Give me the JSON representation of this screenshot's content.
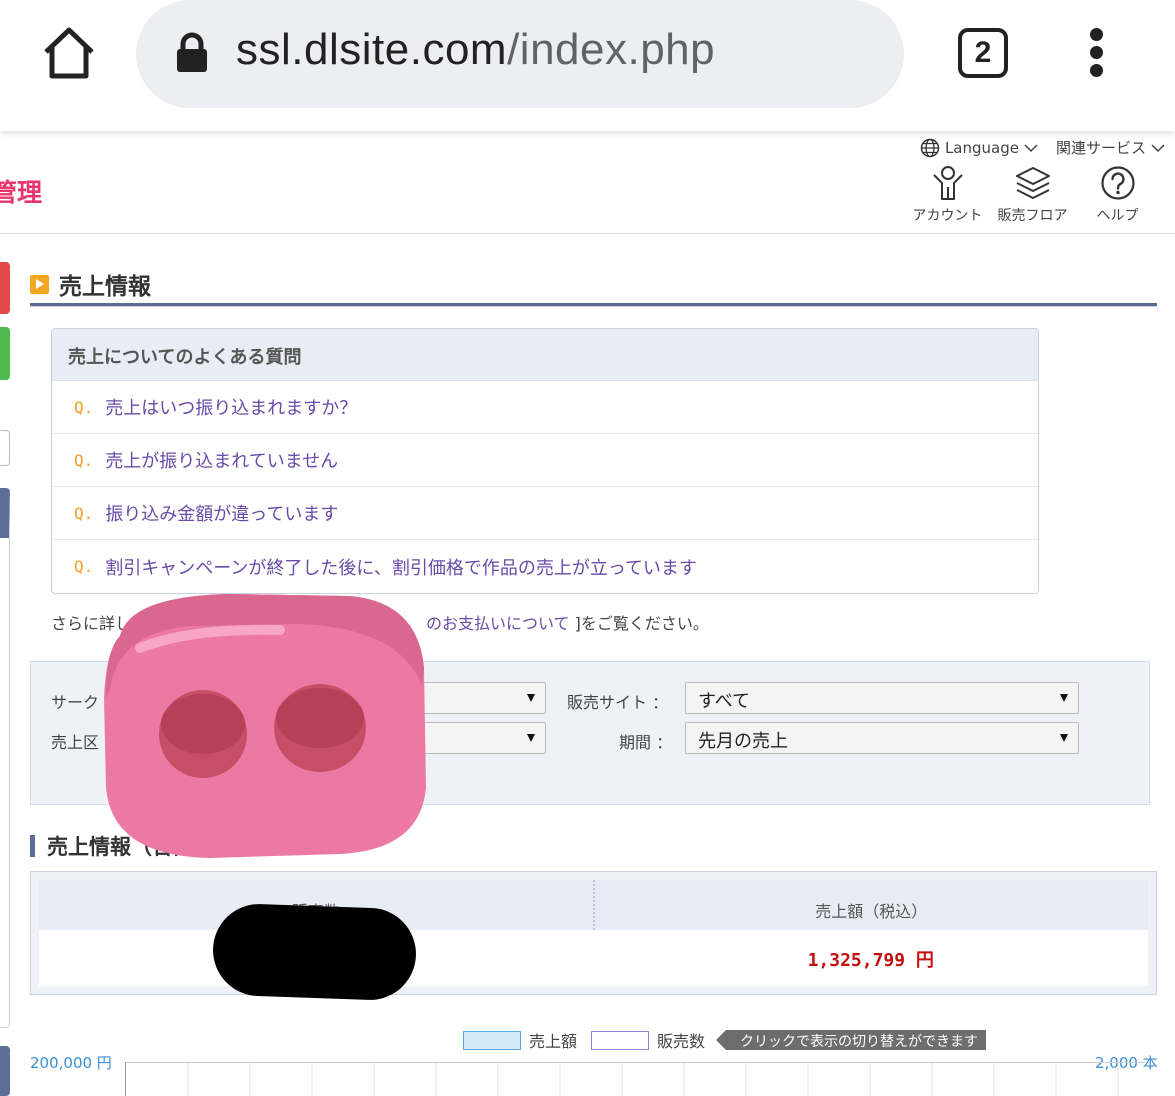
{
  "browser": {
    "url_host": "ssl.dlsite.com",
    "url_path": "/index.php",
    "tab_count": "2"
  },
  "header": {
    "brand_fragment": "管理",
    "language_label": "Language",
    "related_services_label": "関連サービス",
    "nav": [
      {
        "label": "アカウント",
        "icon": "account-icon"
      },
      {
        "label": "販売フロア",
        "icon": "layers-icon"
      },
      {
        "label": "ヘルプ",
        "icon": "help-icon"
      }
    ]
  },
  "section_title": "売上情報",
  "faq": {
    "heading": "売上についてのよくある質問",
    "q_marker": "Q.",
    "items": [
      "売上はいつ振り込まれますか？",
      "売上が振り込まれていません",
      "振り込み金額が違っています",
      "割引キャンペーンが終了した後に、割引価格で作品の売上が立っています"
    ]
  },
  "more_info": {
    "prefix": "さらに詳し",
    "link": "のお支払いについて",
    "suffix": " ]をご覧ください。"
  },
  "filter": {
    "circle_label": "サーク",
    "sales_type_label": "売上区",
    "site_label": "販売サイト ：",
    "site_value": "すべて",
    "period_label": "期間 ：",
    "period_value": "先月の売上"
  },
  "summary": {
    "title": "売上情報（合計",
    "col_count": "販売数",
    "col_amount": "売上額（税込）",
    "amount_value": "1,325,799 円"
  },
  "chart": {
    "legend_amount": "売上額",
    "legend_count": "販売数",
    "hint": "クリックで表示の切り替えができます",
    "y_left_top": "200,000 円",
    "y_right_top": "2,000 本",
    "colors": {
      "amount": "#d6eaf8",
      "count": "#ffffff",
      "amount_border": "#5aaee0",
      "count_border": "#9a7fd8",
      "axis_text": "#3a8fd6"
    }
  }
}
